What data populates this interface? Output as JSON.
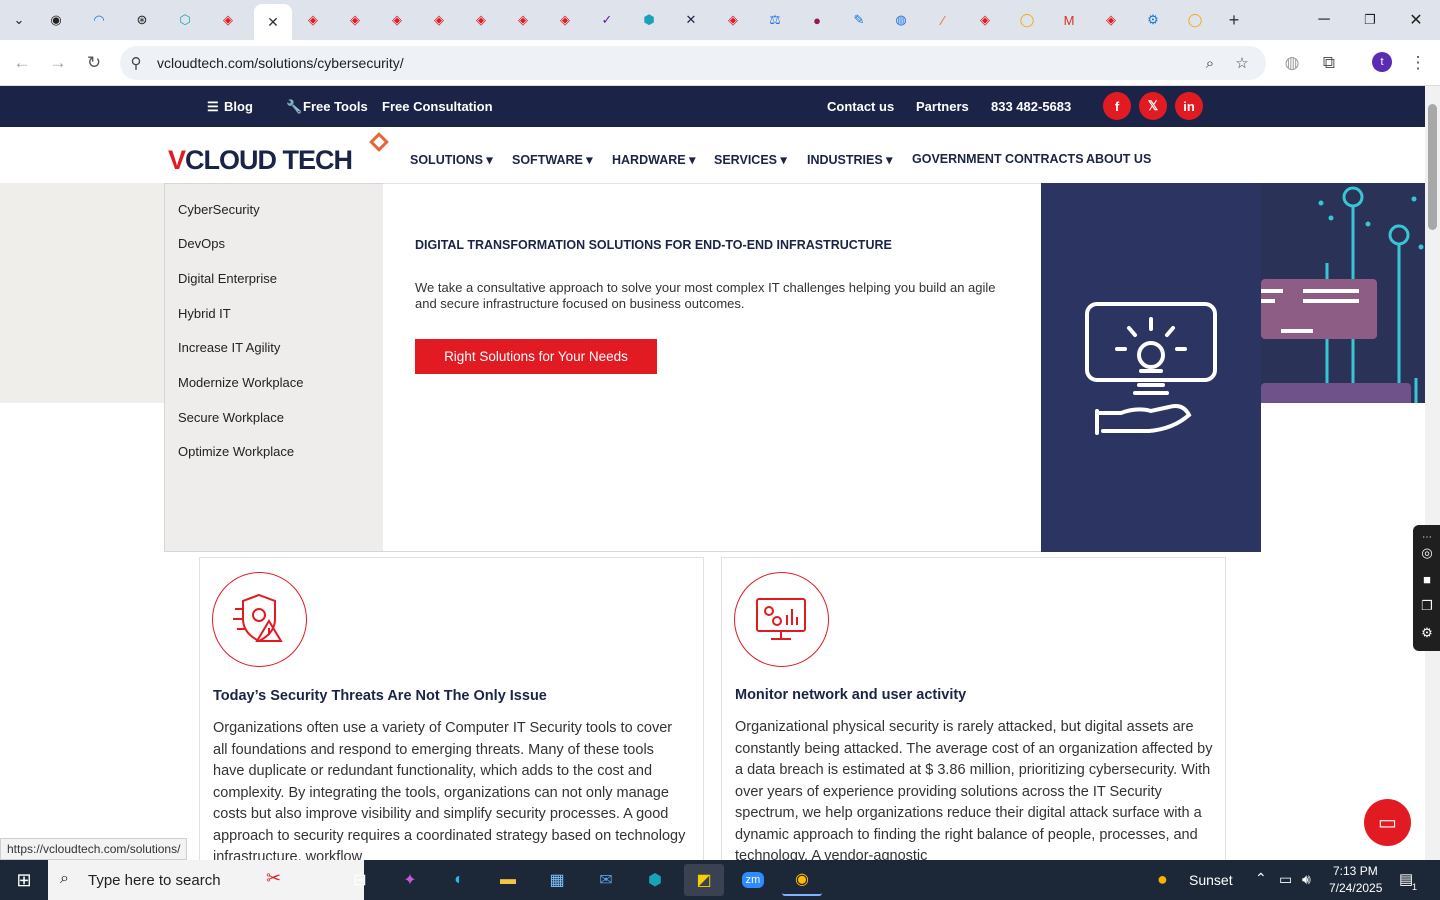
{
  "browser": {
    "url": "vcloudtech.com/solutions/cybersecurity/",
    "status_url": "https://vcloudtech.com/solutions/"
  },
  "topbar": {
    "blog": "Blog",
    "free_tools": "Free Tools",
    "free_consultation": "Free Consultation",
    "contact": "Contact us",
    "partners": "Partners",
    "phone": "833 482-5683"
  },
  "logo": {
    "part1": "V",
    "part2": "CLOUD TECH"
  },
  "nav": [
    {
      "label": "SOLUTIONS ▾"
    },
    {
      "label": "SOFTWARE ▾"
    },
    {
      "label": "HARDWARE ▾"
    },
    {
      "label": "SERVICES ▾"
    },
    {
      "label": "INDUSTRIES ▾"
    },
    {
      "label": "GOVERNMENT CONTRACTS"
    },
    {
      "label": "ABOUT US"
    }
  ],
  "solutions_menu": [
    "CyberSecurity",
    "DevOps",
    "Digital Enterprise",
    "Hybrid IT",
    "Increase IT Agility",
    "Modernize Workplace",
    "Secure Workplace",
    "Optimize Workplace"
  ],
  "mega": {
    "heading": "DIGITAL TRANSFORMATION SOLUTIONS FOR END-TO-END INFRASTRUCTURE",
    "description": "We take a consultative approach to solve your most complex IT challenges helping you build an agile and secure infrastructure focused on business outcomes.",
    "cta": "Right Solutions for Your Needs"
  },
  "cards": [
    {
      "title": "Today’s Security Threats Are Not The Only Issue",
      "body": "Organizations often use a variety of Computer IT Security tools to cover all foundations and respond to emerging threats. Many of these tools have duplicate or redundant functionality, which adds to the cost and complexity. By integrating the tools, organizations can not only manage costs but also improve visibility and simplify security processes. A good approach to security requires a coordinated strategy based on technology infrastructure, workflow"
    },
    {
      "title": "Monitor network and user activity",
      "body": "Organizational physical security is rarely attacked, but digital assets are constantly being attacked. The average cost of an organization affected by a data breach is estimated at $ 3.86 million, prioritizing cybersecurity. With over years of experience providing solutions across the IT Security spectrum, we help organizations reduce their digital attack surface with a dynamic approach to finding the right balance of people, processes, and technology. A vendor-agnostic"
    }
  ],
  "taskbar": {
    "search_placeholder": "Type here to search",
    "weather": "Sunset",
    "time": "7:13 PM",
    "date": "7/24/2025",
    "notif_count": "1"
  },
  "colors": {
    "brand_red": "#e21b23",
    "navy": "#1b2447",
    "panel": "#2c3562"
  }
}
